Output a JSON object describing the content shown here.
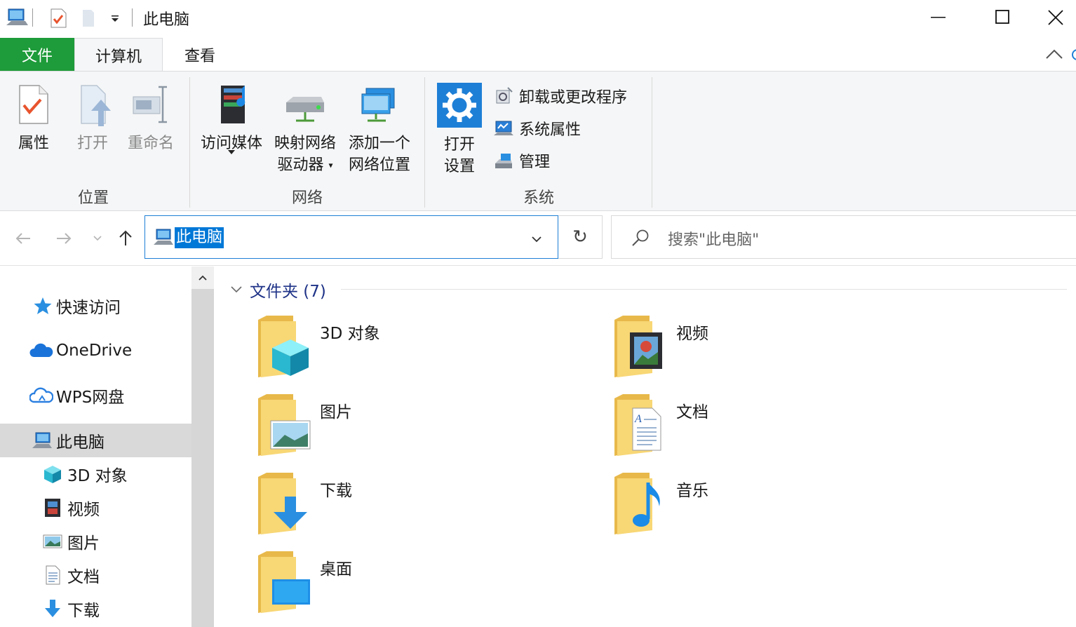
{
  "window": {
    "title": "此电脑",
    "controls": [
      "minimize",
      "maximize",
      "close"
    ]
  },
  "ribbon": {
    "tabs": [
      {
        "label": "文件"
      },
      {
        "label": "计算机"
      },
      {
        "label": "查看"
      }
    ],
    "groups": {
      "location": {
        "label": "位置",
        "buttons": {
          "properties": "属性",
          "open": "打开",
          "rename": "重命名"
        }
      },
      "network": {
        "label": "网络",
        "buttons": {
          "access_media": "访问媒体",
          "map_drive_1": "映射网络",
          "map_drive_2": "驱动器",
          "add_location_1": "添加一个",
          "add_location_2": "网络位置"
        }
      },
      "system": {
        "label": "系统",
        "open_settings_1": "打开",
        "open_settings_2": "设置",
        "items": {
          "uninstall": "卸载或更改程序",
          "system_properties": "系统属性",
          "manage": "管理"
        }
      }
    }
  },
  "address_bar": {
    "path": "此电脑",
    "search_placeholder": "搜索\"此电脑\""
  },
  "nav_pane": {
    "quick_access": "快速访问",
    "onedrive": "OneDrive",
    "wps": "WPS网盘",
    "this_pc": "此电脑",
    "children": {
      "objects3d": "3D 对象",
      "videos": "视频",
      "pictures": "图片",
      "documents": "文档",
      "downloads": "下载"
    }
  },
  "content": {
    "group_header": "文件夹 (7)",
    "folders": {
      "objects3d": "3D 对象",
      "videos": "视频",
      "pictures": "图片",
      "documents": "文档",
      "downloads": "下载",
      "music": "音乐",
      "desktop": "桌面"
    }
  },
  "colors": {
    "file_tab": "#1e9b3a",
    "selection": "#0078d7",
    "group_header": "#1e3287",
    "folder_yellow": "#f8d775"
  }
}
